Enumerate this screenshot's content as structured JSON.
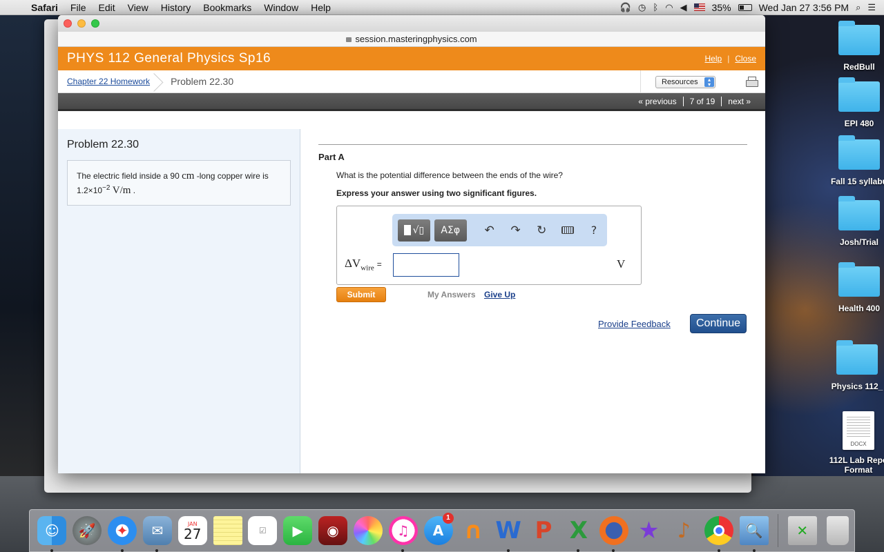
{
  "menubar": {
    "app_name": "Safari",
    "items": [
      "File",
      "Edit",
      "View",
      "History",
      "Bookmarks",
      "Window",
      "Help"
    ],
    "battery": "35%",
    "clock": "Wed Jan 27  3:56 PM"
  },
  "browser": {
    "url": "session.masteringphysics.com"
  },
  "course": {
    "title": "PHYS 112 General Physics Sp16",
    "help_label": "Help",
    "close_label": "Close"
  },
  "breadcrumb": {
    "parent": "Chapter 22 Homework",
    "current": "Problem 22.30",
    "resources_label": "Resources"
  },
  "pager": {
    "previous": "« previous",
    "position": "7 of 19",
    "next": "next »"
  },
  "problem": {
    "title": "Problem 22.30",
    "statement_part1": "The electric field inside a 90 ",
    "statement_unit1": "cm",
    "statement_part2": " -long copper wire is 1.2×10",
    "statement_exp": "−2",
    "statement_unit2": "V/m",
    "statement_end": " ."
  },
  "part": {
    "label": "Part A",
    "question": "What is the potential difference between the ends of the wire?",
    "instruction": "Express your answer using two significant figures.",
    "toolbar": {
      "templates_label": "√▯",
      "symbols_label": "ΑΣφ",
      "undo": "↶",
      "redo": "↷",
      "reset": "↻",
      "help": "?"
    },
    "variable": "ΔV",
    "variable_sub": "wire",
    "equals": "=",
    "answer_value": "",
    "unit": "V",
    "submit_label": "Submit",
    "my_answers_label": "My Answers",
    "give_up_label": "Give Up"
  },
  "footer": {
    "feedback_label": "Provide Feedback",
    "continue_label": "Continue"
  },
  "desktop": {
    "icons": [
      "RedBull",
      "EPI 480",
      "Fall 15 syllabu",
      "Josh/Trial",
      "Health 400",
      "Physics 112_",
      "112L Lab Repo Format"
    ],
    "docx_label": "DOCX"
  },
  "dock": {
    "calendar_month": "JAN",
    "calendar_day": "27",
    "appstore_badge": "1"
  },
  "colors": {
    "course_bar": "#ee8a1b",
    "submit": "#e6800f",
    "continue": "#214f8e",
    "link": "#1a3f8a"
  }
}
